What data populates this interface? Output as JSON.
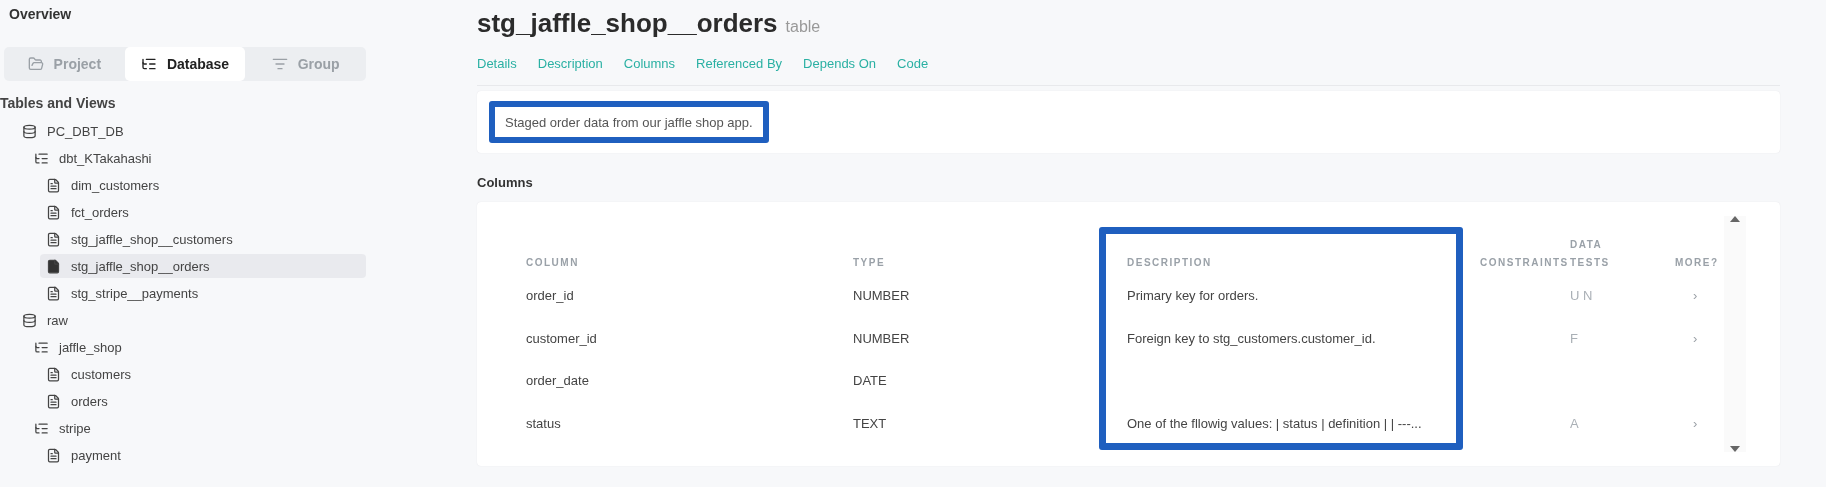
{
  "sidebar": {
    "title": "Overview",
    "view_tabs": [
      {
        "label": "Project",
        "selected": false
      },
      {
        "label": "Database",
        "selected": true
      },
      {
        "label": "Group",
        "selected": false
      }
    ],
    "section_title": "Tables and Views",
    "tree": [
      {
        "label": "PC_DBT_DB",
        "kind": "database",
        "children": [
          {
            "label": "dbt_KTakahashi",
            "kind": "schema",
            "children": [
              {
                "label": "dim_customers",
                "kind": "table",
                "selected": false
              },
              {
                "label": "fct_orders",
                "kind": "table",
                "selected": false
              },
              {
                "label": "stg_jaffle_shop__customers",
                "kind": "table",
                "selected": false
              },
              {
                "label": "stg_jaffle_shop__orders",
                "kind": "table",
                "selected": true
              },
              {
                "label": "stg_stripe__payments",
                "kind": "table",
                "selected": false
              }
            ]
          }
        ]
      },
      {
        "label": "raw",
        "kind": "database",
        "children": [
          {
            "label": "jaffle_shop",
            "kind": "schema",
            "children": [
              {
                "label": "customers",
                "kind": "table",
                "selected": false
              },
              {
                "label": "orders",
                "kind": "table",
                "selected": false
              }
            ]
          },
          {
            "label": "stripe",
            "kind": "schema",
            "children": [
              {
                "label": "payment",
                "kind": "table",
                "selected": false
              }
            ]
          }
        ]
      }
    ]
  },
  "header": {
    "title": "stg_jaffle_shop__orders",
    "type": "table",
    "links": [
      "Details",
      "Description",
      "Columns",
      "Referenced By",
      "Depends On",
      "Code"
    ]
  },
  "description": {
    "text": "Staged order data from our jaffle shop app.",
    "highlighted": true
  },
  "columns_section": {
    "title": "Columns",
    "headers": [
      {
        "label": "COLUMN",
        "highlighted": false
      },
      {
        "label": "TYPE",
        "highlighted": false
      },
      {
        "label": "DESCRIPTION",
        "highlighted": true
      },
      {
        "label": "CONSTRAINTS",
        "highlighted": false
      },
      {
        "label": "DATA\nTESTS",
        "highlighted": false
      },
      {
        "label": "MORE?",
        "highlighted": false
      }
    ],
    "rows": [
      {
        "column": "order_id",
        "type": "NUMBER",
        "description": "Primary key for orders.",
        "data_tests": "U N",
        "more": "›"
      },
      {
        "column": "customer_id",
        "type": "NUMBER",
        "description": "Foreign key to stg_customers.customer_id.",
        "data_tests": "F",
        "more": "›"
      },
      {
        "column": "order_date",
        "type": "DATE"
      },
      {
        "column": "status",
        "type": "TEXT",
        "description": "One of the fllowig values: | status | definition | | ---...",
        "data_tests": "A",
        "more": "›"
      }
    ]
  }
}
